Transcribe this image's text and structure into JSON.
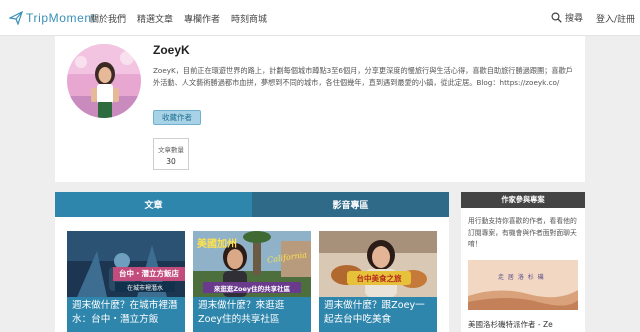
{
  "site": {
    "logo_text": "TripMoment"
  },
  "nav": {
    "items": [
      "關於我們",
      "精選文章",
      "專欄作者",
      "時刻商城"
    ]
  },
  "header": {
    "search_label": "搜尋",
    "login_label": "登入/註冊"
  },
  "profile": {
    "name": "ZoeyK",
    "bio": "ZoeyK，目前正在環遊世界的路上，計劃每個城市蹲點3至6個月，分享更深度的慢旅行與生活心得，喜歡自助旅行勝過跟團；喜歡戶外活動、人文藝術勝過都市血拼，夢想到不同的城市，各住個幾年，直到遇到最愛的小鎮，從此定居。Blog：https://zoeyk.co/",
    "follow_label": "收藏作者",
    "stat_label": "文章數量",
    "stat_value": "30"
  },
  "tabs": [
    {
      "label": "文章",
      "active": true
    },
    {
      "label": "影音專區",
      "active": false
    }
  ],
  "articles": [
    {
      "title": "週末做什麼？在城市裡潛水：台中・潛立方飯",
      "thumb_caption": "台中・潛立方飯店",
      "thumb_sub": "在城市裡潛水"
    },
    {
      "title": "週末做什麼？來逛逛Zoey住的共享社區",
      "thumb_caption": "來逛逛Zoey住的共享社區",
      "thumb_top": "美國加州",
      "thumb_script": "California"
    },
    {
      "title": "週末做什麼？跟Zoey一起去台中吃美食",
      "thumb_caption": "台中美食之旅"
    }
  ],
  "sidebar": {
    "title": "作家參與專案",
    "description": "用行動支持你喜歡的作者，看看他的訂閱專案，有機會與作者面對面聊天唷！",
    "caption": "美國洛杉磯特派作者 - Ze",
    "img_text": "走 居 洛 杉 磯"
  },
  "colors": {
    "accent": "#2f86ad",
    "tab_inactive": "#2f6a88",
    "sidebar_header": "#444444",
    "follow_bg": "#a8d3e6"
  }
}
